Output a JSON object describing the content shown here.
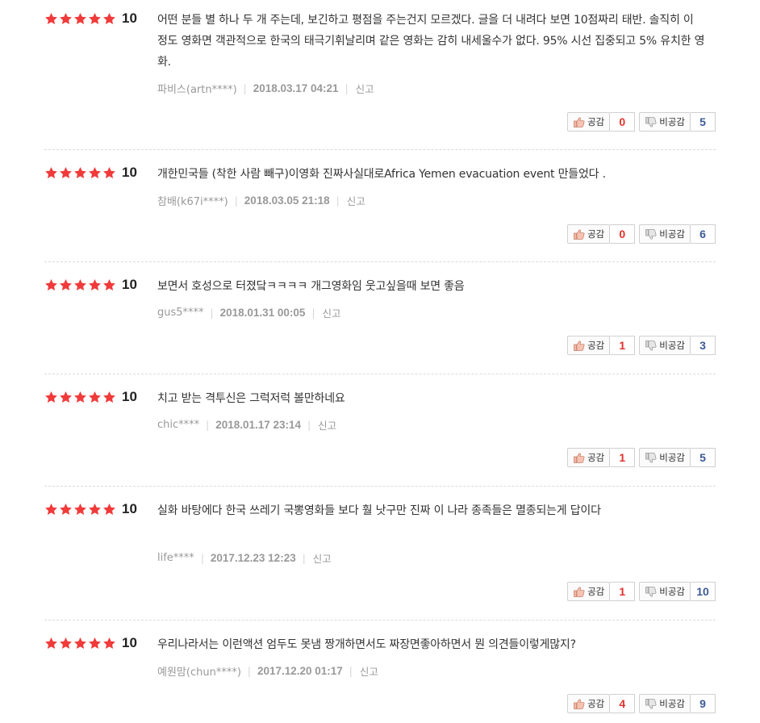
{
  "colors": {
    "star": "#f13a3a",
    "like_count": "#e0332c",
    "dislike_count": "#3d5a94",
    "divider": "#d9d9d9"
  },
  "icons": {
    "star": "star-icon",
    "like": "thumbs-up-icon",
    "dislike": "thumbs-down-icon"
  },
  "reviews": [
    {
      "rating": 5,
      "score": "10",
      "text": "어떤 분들 별 하나 두 개 주는데, 보긴하고 평점을 주는건지 모르겠다. 글을 더 내려다 보면 10점짜리 태반. 솔직히 이 정도 영화면 객관적으로 한국의 태극기휘날리며 같은 영화는 감히 내세울수가 없다. 95% 시선 집중되고 5% 유치한 영화.",
      "author": "파비스(artn****)",
      "date": "2018.03.17 04:21",
      "report": "신고",
      "like_label": "공감",
      "like_count": "0",
      "dislike_label": "비공감",
      "dislike_count": "5"
    },
    {
      "rating": 5,
      "score": "10",
      "text": "개한민국들 (착한 사람 빼구)이영화 진짜사실대로Africa Yemen evacuation event 만들었다 .",
      "author": "참배(k67i****)",
      "date": "2018.03.05 21:18",
      "report": "신고",
      "like_label": "공감",
      "like_count": "0",
      "dislike_label": "비공감",
      "dislike_count": "6"
    },
    {
      "rating": 5,
      "score": "10",
      "text": "보면서 호성으로 터졌닼ㅋㅋㅋㅋ 개그영화임 웃고싶을때 보면 좋음",
      "author": "gus5****",
      "date": "2018.01.31 00:05",
      "report": "신고",
      "like_label": "공감",
      "like_count": "1",
      "dislike_label": "비공감",
      "dislike_count": "3"
    },
    {
      "rating": 5,
      "score": "10",
      "text": "치고 받는 격투신은 그럭저럭 볼만하네요",
      "author": "chic****",
      "date": "2018.01.17 23:14",
      "report": "신고",
      "like_label": "공감",
      "like_count": "1",
      "dislike_label": "비공감",
      "dislike_count": "5"
    },
    {
      "rating": 5,
      "score": "10",
      "text": "실화 바탕에다 한국 쓰레기 국뽕영화들 보다 훨 낫구만 진짜 이 나라 종족들은 멸종되는게 답이다",
      "author": "life****",
      "date": "2017.12.23 12:23",
      "report": "신고",
      "like_label": "공감",
      "like_count": "1",
      "dislike_label": "비공감",
      "dislike_count": "10"
    },
    {
      "rating": 5,
      "score": "10",
      "text": "우리나라서는 이런액션 엄두도 못냄 짱개하면서도 짜장면좋아하면서 뭔 의견들이렇게많지?",
      "author": "예원맘(chun****)",
      "date": "2017.12.20 01:17",
      "report": "신고",
      "like_label": "공감",
      "like_count": "4",
      "dislike_label": "비공감",
      "dislike_count": "9"
    }
  ]
}
